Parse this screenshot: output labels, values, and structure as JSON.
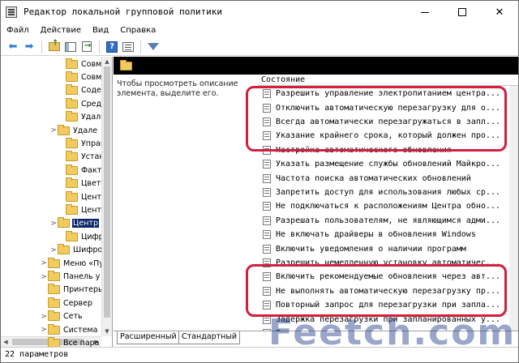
{
  "window": {
    "title": "Редактор локальной групповой политики",
    "minimize_label": "—",
    "maximize_label": "",
    "close_label": "✕"
  },
  "menu": [
    "Файл",
    "Действие",
    "Вид",
    "Справка"
  ],
  "toolbar": {
    "icons": [
      "back-arrow-icon",
      "forward-arrow-icon",
      "folder-up-icon",
      "show-tree-icon",
      "export-list-icon",
      "help-icon",
      "properties-icon",
      "filter-icon"
    ],
    "help_glyph": "?"
  },
  "tree": [
    {
      "label": "Совме",
      "expander": ""
    },
    {
      "label": "Совме",
      "expander": ""
    },
    {
      "label": "Содер",
      "expander": ""
    },
    {
      "label": "Среда",
      "expander": ""
    },
    {
      "label": "Удале",
      "expander": ""
    },
    {
      "label": "Удале",
      "expander": ">"
    },
    {
      "label": "Управ",
      "expander": ""
    },
    {
      "label": "Устан",
      "expander": ""
    },
    {
      "label": "Факто",
      "expander": ""
    },
    {
      "label": "Цвето",
      "expander": ""
    },
    {
      "label": "Центр",
      "expander": ""
    },
    {
      "label": "Центр",
      "expander": ""
    },
    {
      "label": "Центр",
      "expander": ">",
      "selected": true
    },
    {
      "label": "Цифро",
      "expander": ""
    },
    {
      "label": "Шифро",
      "expander": ">"
    },
    {
      "label": "Меню «Пу",
      "expander": ">"
    },
    {
      "label": "Панель у",
      "expander": ">"
    },
    {
      "label": "Принтеры",
      "expander": ""
    },
    {
      "label": "Сервер",
      "expander": ""
    },
    {
      "label": "Сеть",
      "expander": ">"
    },
    {
      "label": "Система",
      "expander": ">"
    },
    {
      "label": "Все пара",
      "expander": ""
    }
  ],
  "details": {
    "description": "Чтобы просмотреть описание элемента, выделите его.",
    "column_header": "Состояние"
  },
  "policies": [
    "Разрешить управление электропитанием центра...",
    "Отключить автоматическую перезагрузку для о...",
    "Всегда автоматически перезагружаться в запл...",
    "Указание крайнего срока, который должен про...",
    "Настройка автоматического обновления",
    "Указать размещение службы обновлений Майкро...",
    "Частота поиска автоматических обновлений",
    "Запретить доступ для использования любых ср...",
    "Не подключаться к расположениям Центра обно...",
    "Разрешать пользователям, не являющимся адми...",
    "Не включать драйверы в обновления Windows",
    "Включить уведомления о наличии программ",
    "Разрешить немедленную установку автоматичес...",
    "Включить рекомендуемые обновления через авт...",
    "Не выполнять автоматическую перезагрузку пр...",
    "Повторный запрос для перезагрузки при запла...",
    "Задержка перезагрузки при запланированных у...",
    "Перенос запланированных установок автоматич..."
  ],
  "tabs": [
    "Расширенный",
    "Стандартный"
  ],
  "status": "22 параметров",
  "watermark": "Feetch.com",
  "colors": {
    "highlight": "#d21f3c",
    "selection": "#0a246a",
    "folder": "#f2cb5e"
  }
}
